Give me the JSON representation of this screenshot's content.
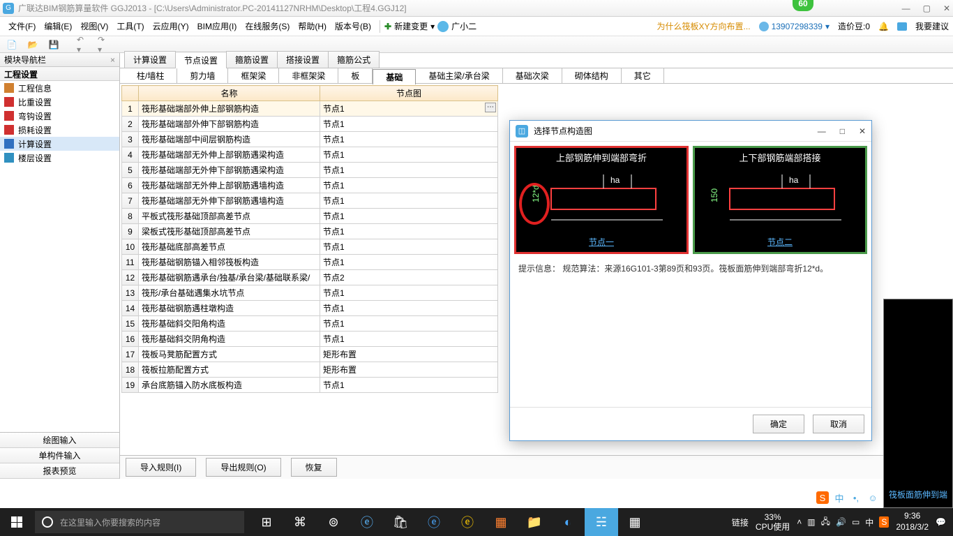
{
  "title": "广联达BIM钢筋算量软件 GGJ2013 - [C:\\Users\\Administrator.PC-20141127NRHM\\Desktop\\工程4.GGJ12]",
  "badge": "60",
  "menus": [
    "文件(F)",
    "编辑(E)",
    "视图(V)",
    "工具(T)",
    "云应用(Y)",
    "BIM应用(I)",
    "在线服务(S)",
    "帮助(H)",
    "版本号(B)"
  ],
  "newchange": "新建变更",
  "username_small": "广小二",
  "warn_text": "为什么筏板XY方向布置...",
  "phone": "13907298339",
  "credits_label": "造价豆:0",
  "feedback": "我要建议",
  "nav_header": "模块导航栏",
  "nav_title": "工程设置",
  "nav_items": [
    {
      "label": "工程信息",
      "color": "#d08030"
    },
    {
      "label": "比重设置",
      "color": "#d03030"
    },
    {
      "label": "弯钩设置",
      "color": "#d03030"
    },
    {
      "label": "损耗设置",
      "color": "#d03030"
    },
    {
      "label": "计算设置",
      "color": "#3070c0",
      "sel": true
    },
    {
      "label": "楼层设置",
      "color": "#3090c0"
    }
  ],
  "nav_bottom": [
    "绘图输入",
    "单构件输入",
    "报表预览"
  ],
  "tabs1": [
    "计算设置",
    "节点设置",
    "箍筋设置",
    "搭接设置",
    "箍筋公式"
  ],
  "tabs1_active": 1,
  "tabs2": [
    "柱/墙柱",
    "剪力墙",
    "框架梁",
    "非框架梁",
    "板",
    "基础",
    "基础主梁/承台梁",
    "基础次梁",
    "砌体结构",
    "其它"
  ],
  "tabs2_active": 5,
  "col_name": "名称",
  "col_node": "节点图",
  "rows": [
    {
      "n": "筏形基础端部外伸上部钢筋构造",
      "v": "节点1"
    },
    {
      "n": "筏形基础端部外伸下部钢筋构造",
      "v": "节点1"
    },
    {
      "n": "筏形基础端部中间层钢筋构造",
      "v": "节点1"
    },
    {
      "n": "筏形基础端部无外伸上部钢筋遇梁构造",
      "v": "节点1"
    },
    {
      "n": "筏形基础端部无外伸下部钢筋遇梁构造",
      "v": "节点1"
    },
    {
      "n": "筏形基础端部无外伸上部钢筋遇墙构造",
      "v": "节点1"
    },
    {
      "n": "筏形基础端部无外伸下部钢筋遇墙构造",
      "v": "节点1"
    },
    {
      "n": "平板式筏形基础顶部高差节点",
      "v": "节点1"
    },
    {
      "n": "梁板式筏形基础顶部高差节点",
      "v": "节点1"
    },
    {
      "n": "筏形基础底部高差节点",
      "v": "节点1"
    },
    {
      "n": "筏形基础钢筋锚入相邻筏板构造",
      "v": "节点1"
    },
    {
      "n": "筏形基础钢筋遇承台/独基/承台梁/基础联系梁/",
      "v": "节点2"
    },
    {
      "n": "筏形/承台基础遇集水坑节点",
      "v": "节点1"
    },
    {
      "n": "筏形基础钢筋遇柱墩构造",
      "v": "节点1"
    },
    {
      "n": "筏形基础斜交阳角构造",
      "v": "节点1"
    },
    {
      "n": "筏形基础斜交阴角构造",
      "v": "节点1"
    },
    {
      "n": "筏板马凳筋配置方式",
      "v": "矩形布置"
    },
    {
      "n": "筏板拉筋配置方式",
      "v": "矩形布置"
    },
    {
      "n": "承台底筋锚入防水底板构造",
      "v": "节点1"
    }
  ],
  "bottom_btns": [
    "导入规则(I)",
    "导出规则(O)",
    "恢复"
  ],
  "dialog": {
    "title": "选择节点构造图",
    "opt1_title": "上部钢筋伸到端部弯折",
    "opt1_link": "节点一",
    "opt1_ha": "ha",
    "opt1_dim": "12*d",
    "opt2_title": "上下部钢筋端部搭接",
    "opt2_link": "节点二",
    "opt2_ha": "ha",
    "opt2_dim": "150",
    "hint": "提示信息：  规范算法：来源16G101-3第89页和93页。筏板面筋伸到端部弯折12*d。",
    "ok": "确定",
    "cancel": "取消"
  },
  "rightpeek": "筏板面筋伸到端",
  "taskbar": {
    "search_placeholder": "在这里输入你要搜索的内容",
    "link": "链接",
    "cpu_pct": "33%",
    "cpu_label": "CPU使用",
    "time": "9:36",
    "date": "2018/3/2",
    "ime": "中"
  },
  "ime_items": [
    "S",
    "中",
    "",
    "",
    "",
    "",
    "",
    ""
  ]
}
